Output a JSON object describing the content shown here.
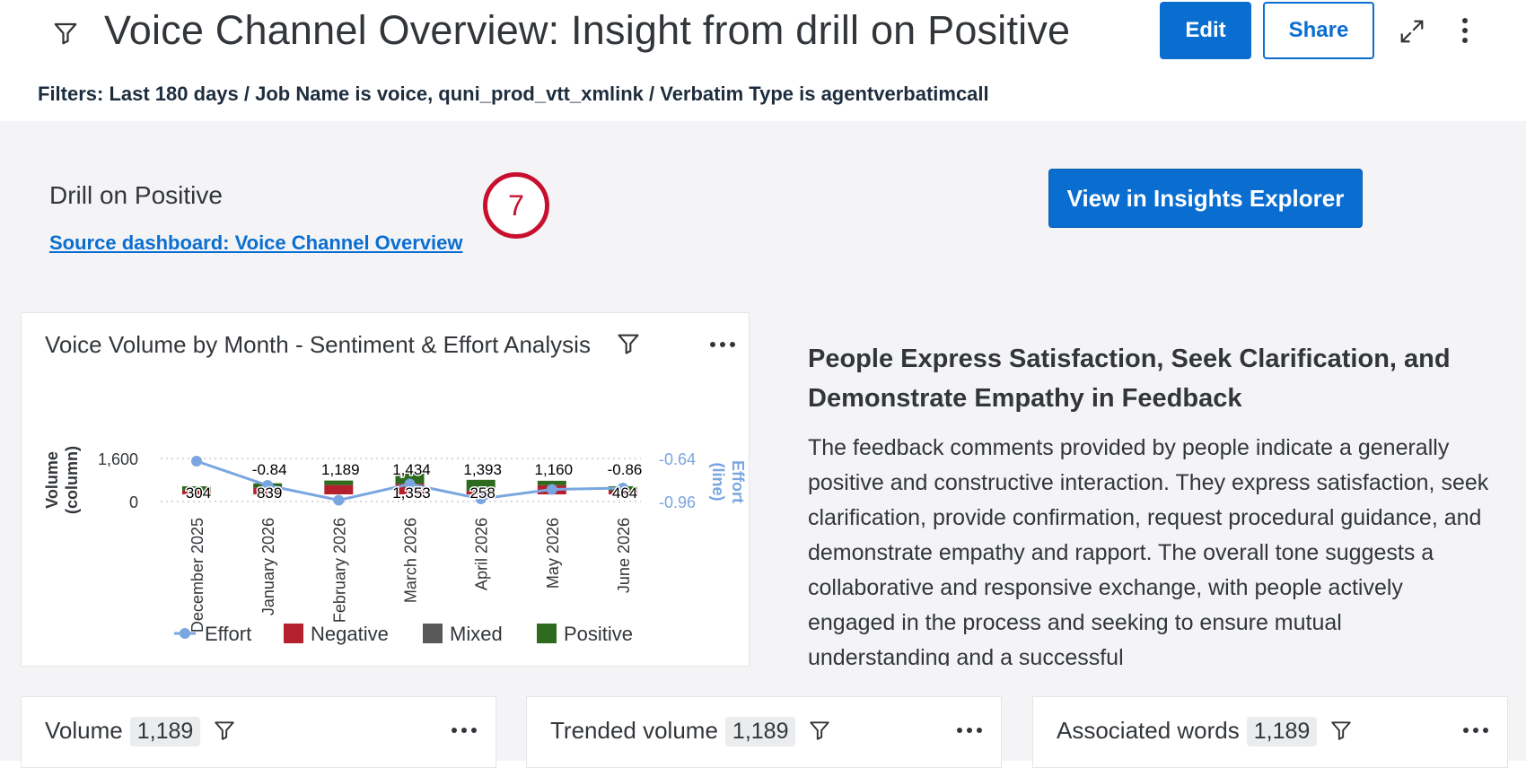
{
  "header": {
    "title": "Voice Channel Overview: Insight from drill on Positive",
    "edit_label": "Edit",
    "share_label": "Share",
    "filters_text": "Filters: Last 180 days / Job Name is voice, quni_prod_vtt_xmlink / Verbatim Type is agentverbatimcall"
  },
  "drill": {
    "title": "Drill on Positive",
    "source_link": "Source dashboard: Voice Channel Overview",
    "step_number": "7",
    "view_button": "View in Insights Explorer"
  },
  "chart_card": {
    "title": "Voice Volume by Month - Sentiment & Effort Analysis"
  },
  "chart_data": {
    "type": "bar",
    "title": "Voice Volume by Month - Sentiment & Effort Analysis",
    "categories": [
      "December 2025",
      "January 2026",
      "February 2026",
      "March 2026",
      "April 2026",
      "May 2026",
      "June 2026"
    ],
    "ylabel": "Volume (column)",
    "y2label": "Effort (line)",
    "yticks": [
      "1,600",
      "0"
    ],
    "y2ticks": [
      "-0.64",
      "-0.96"
    ],
    "ylim": [
      0,
      1600
    ],
    "y2lim": [
      -0.96,
      -0.64
    ],
    "series": [
      {
        "name": "Negative",
        "type": "bar",
        "color": "#b5202e",
        "values": [
          304,
          839,
          1189,
          1353,
          258,
          1160,
          464
        ]
      },
      {
        "name": "Positive",
        "type": "bar",
        "color": "#2e6b1f",
        "values": [
          0,
          0,
          0,
          1434,
          1393,
          0,
          0
        ]
      },
      {
        "name": "Mixed",
        "type": "bar",
        "color": "#595959",
        "values": [
          0,
          0,
          0,
          0,
          0,
          0,
          0
        ]
      },
      {
        "name": "Effort",
        "type": "line",
        "color": "#7aa6e0",
        "values": [
          -0.66,
          -0.84,
          -0.95,
          -0.83,
          -0.94,
          -0.87,
          -0.86
        ]
      }
    ],
    "data_labels": {
      "top": [
        "",
        "-0.84",
        "1,189",
        "1,434",
        "1,393",
        "1,160",
        "-0.86"
      ],
      "bottom": [
        "304",
        "839",
        "",
        "1,353",
        "258",
        "",
        "464"
      ]
    },
    "legend": [
      "Effort",
      "Negative",
      "Mixed",
      "Positive"
    ],
    "legend_position": "bottom"
  },
  "insight": {
    "heading": "People Express Satisfaction, Seek Clarification, and Demonstrate Empathy in Feedback",
    "body": "The feedback comments provided by people indicate a generally positive and constructive interaction. They express satisfaction, seek clarification, provide confirmation, request procedural guidance, and demonstrate empathy and rapport. The overall tone suggests a collaborative and responsive exchange, with people actively engaged in the process and seeking to ensure mutual understanding and a successful"
  },
  "bottom_cards": [
    {
      "title": "Volume",
      "count": "1,189"
    },
    {
      "title": "Trended volume",
      "count": "1,189"
    },
    {
      "title": "Associated words",
      "count": "1,189"
    }
  ],
  "colors": {
    "accent": "#0a6ed1",
    "badge_red": "#c8102e",
    "background": "#f4f4f6"
  },
  "icons": [
    "filter-icon",
    "expand-icon",
    "more-vertical-icon",
    "more-horizontal-icon"
  ]
}
